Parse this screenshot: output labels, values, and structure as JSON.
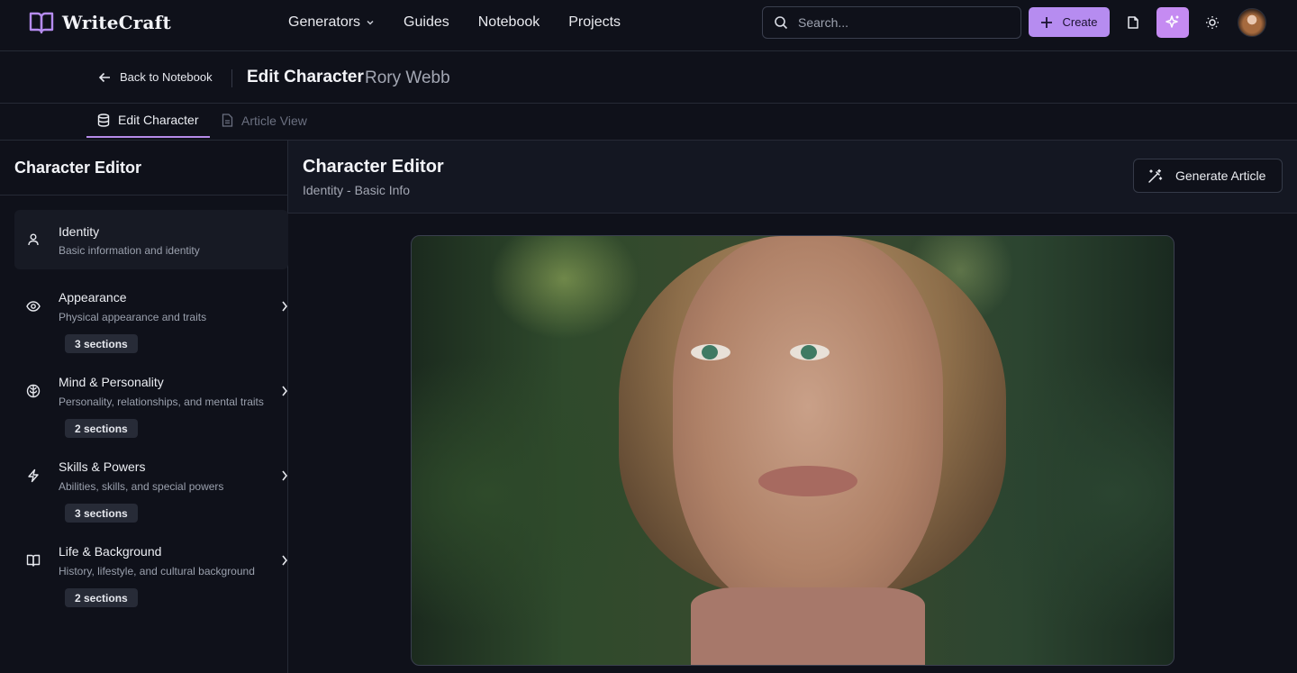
{
  "app": {
    "name": "WriteCraft"
  },
  "nav": {
    "links": [
      "Generators",
      "Guides",
      "Notebook",
      "Projects"
    ],
    "search_placeholder": "Search...",
    "create_label": "Create"
  },
  "subheader": {
    "back_label": "Back to Notebook",
    "title": "Edit Character",
    "character_name": "Rory Webb"
  },
  "tabs": [
    {
      "label": "Edit Character",
      "active": true
    },
    {
      "label": "Article View",
      "active": false
    }
  ],
  "sidebar": {
    "title": "Character Editor",
    "items": [
      {
        "label": "Identity",
        "description": "Basic information and identity",
        "icon": "user-icon",
        "badge": "",
        "selected": true
      },
      {
        "label": "Appearance",
        "description": "Physical appearance and traits",
        "icon": "eye-icon",
        "badge": "3 sections",
        "selected": false
      },
      {
        "label": "Mind & Personality",
        "description": "Personality, relationships, and mental traits",
        "icon": "brain-icon",
        "badge": "2 sections",
        "selected": false
      },
      {
        "label": "Skills & Powers",
        "description": "Abilities, skills, and special powers",
        "icon": "lightning-icon",
        "badge": "3 sections",
        "selected": false
      },
      {
        "label": "Life & Background",
        "description": "History, lifestyle, and cultural background",
        "icon": "book-icon",
        "badge": "2 sections",
        "selected": false
      }
    ]
  },
  "main": {
    "title": "Character Editor",
    "subtitle": "Identity - Basic Info",
    "generate_label": "Generate Article"
  },
  "colors": {
    "background": "#0f111a",
    "accent": "#b68cf0",
    "accent_magic": "#c58bf2",
    "border": "#262a36"
  }
}
